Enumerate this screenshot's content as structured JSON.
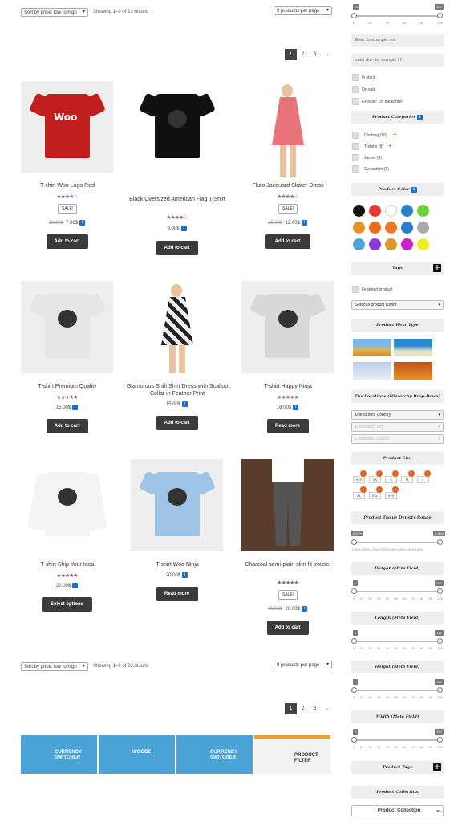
{
  "toolbar": {
    "sort_label": "Sort by price: low to high",
    "result_count": "Showing 1–9 of 23 results",
    "per_page": "9 products per page"
  },
  "pagination": [
    "1",
    "2",
    "3",
    "→"
  ],
  "products": [
    {
      "title": "T-shirt Woo Logo Red",
      "rating": 4,
      "sale": "SALE!",
      "old_price": "10.00$",
      "price": "7.00$",
      "button": "Add to cart"
    },
    {
      "title": "Black Oversized American Flag T-Shirt",
      "rating": 4,
      "sale": "",
      "old_price": "",
      "price": "9.00$",
      "button": "Add to cart"
    },
    {
      "title": "Fluro Jacquard Skater Dress",
      "rating": 4,
      "sale": "SALE!",
      "old_price": "15.00$",
      "price": "12.00$",
      "button": "Add to cart"
    },
    {
      "title": "T-shirt Premium Quality",
      "rating": 4.5,
      "sale": "",
      "old_price": "",
      "price": "15.00$",
      "button": "Add to cart"
    },
    {
      "title": "Glamorous Shift Shirt Dress with Scallop Collar in Feather Print",
      "rating": 0,
      "sale": "",
      "old_price": "",
      "price": "15.00$",
      "button": "Add to cart"
    },
    {
      "title": "T-shirt Happy Ninja",
      "rating": 5,
      "sale": "",
      "old_price": "",
      "price": "18.00$",
      "button": "Read more"
    },
    {
      "title": "T-shirt Ship Your Idea",
      "rating": 4.5,
      "sale": "",
      "old_price": "",
      "price": "20.00$",
      "button": "Select options"
    },
    {
      "title": "T-shirt Woo Ninja",
      "rating": 0,
      "sale": "",
      "old_price": "",
      "price": "20.00$",
      "button": "Read more"
    },
    {
      "title": "Charcoal semi-plain slim fit trouser",
      "rating": 4.5,
      "sale": "SALE!",
      "old_price": "30.00$",
      "price": "20.00$",
      "button": "Add to cart"
    }
  ],
  "product_image_text": {
    "woo": "Woo"
  },
  "banners": [
    {
      "title": "CURRENCY SWITCHER",
      "name": "banner-currency-switcher"
    },
    {
      "title": "WOOBE",
      "name": "banner-woobe"
    },
    {
      "title": "CURRENCY SWITCHER",
      "name": "banner-currency-switcher-2"
    },
    {
      "title": "PRODUCT FILTER",
      "name": "banner-product-filter"
    }
  ],
  "sidebar": {
    "price_slider": {
      "min": "75",
      "max": "100",
      "ticks": [
        "0",
        "20",
        "40",
        "60",
        "80",
        "100"
      ],
      "value_min": 0.75,
      "value_max": 1.0
    },
    "text_search_placeholder": "Enter for example: red",
    "sku_placeholder": "enter sku - for example 77",
    "checks": [
      "In stock",
      "On sale",
      "Exclude: On backorder"
    ],
    "categories_title": "Product Categories",
    "categories": [
      "Clothing (16)",
      "T-shirts (8)",
      "Jacket (3)",
      "Sweatshirt (1)"
    ],
    "color_title": "Product Color",
    "colors": [
      "#111111",
      "#e43a2f",
      "#ffffff",
      "#2a80c9",
      "#6ad13a",
      "#e3932a",
      "#f06a1e",
      "#f0762a",
      "#2a7ad2",
      "#aaaaaa",
      "#4aa6d6",
      "#8a3ad6",
      "#d69a2a",
      "#cc22cc",
      "#eeee22"
    ],
    "tags_title": "Tags",
    "featured_label": "Featured product",
    "author_select": "Select a product author",
    "wear_title": "Product Wear Type",
    "locations_title": "The Locations (Hierarchy Drop-Down)",
    "locations": [
      "Distributors Country",
      "Distributors City",
      "Distributors District"
    ],
    "size_title": "Product Size",
    "sizes": [
      "XXS",
      "XS",
      "S",
      "M",
      "L",
      "XL",
      "XXL",
      "XXX"
    ],
    "size_counts": [
      "1",
      "1",
      "1",
      "1",
      "1",
      "1",
      "1",
      "1"
    ],
    "density_title": "Product Tissue Density Range",
    "density_min": "0.10%",
    "density_max": "0.50%",
    "density_ticks": "0.10%  0.20% 0.25% 0.30% 0.35% 0.40% 0.45% 0.50%",
    "weight_title": "Weight (Meta Field)",
    "weight_min": "0",
    "weight_max": "100",
    "length_title": "Length (Meta Field)",
    "length_min": "0",
    "length_max": "100",
    "height_title": "Height (Meta Field)",
    "height_min": "0",
    "height_max": "100",
    "width_title": "Width (Meta Field)",
    "width_min": "0",
    "width_max": "100",
    "meta_ticks": [
      "0",
      "10",
      "20",
      "30",
      "40",
      "50",
      "60",
      "70",
      "80",
      "90",
      "100"
    ],
    "product_tags_title": "Product Tags",
    "collection_title": "Product Collection",
    "collection_select": "Product Collection"
  }
}
